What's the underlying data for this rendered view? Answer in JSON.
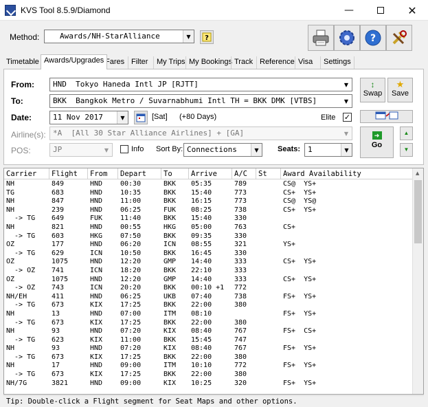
{
  "window": {
    "title": "KVS Tool 8.5.9/Diamond"
  },
  "method": {
    "label": "Method:",
    "value": "Awards/NH-StarAlliance"
  },
  "toolbar": {
    "printer_icon": "printer-icon",
    "settings_icon": "gear-icon",
    "help_icon": "help-icon",
    "tools_icon": "tools-icon"
  },
  "tabs": [
    "Timetable",
    "Awards/Upgrades",
    "Fares",
    "Filter",
    "My Trips",
    "My Bookings",
    "Track",
    "Reference",
    "Visa",
    "Settings"
  ],
  "form": {
    "from_label": "From:",
    "from_value": "HND  Tokyo Haneda Intl JP [RJTT]",
    "to_label": "To:",
    "to_value": "BKK  Bangkok Metro / Suvarnabhumi Intl TH = BKK DMK [VTBS]",
    "date_label": "Date:",
    "date_value": "11 Nov 2017",
    "day_value": "[Sat]",
    "days_offset": "(+80 Days)",
    "elite_label": "Elite",
    "elite_checked": "✓",
    "airlines_label": "Airline(s):",
    "airlines_value": "*A  [All 30 Star Alliance Airlines] + [GA]",
    "pos_label": "POS:",
    "pos_value": "JP",
    "info_label": "Info",
    "sortby_label": "Sort By:",
    "sortby_value": "Connections",
    "seats_label": "Seats:",
    "seats_value": "1",
    "swap_label": "Swap",
    "save_label": "Save",
    "go_label": "Go"
  },
  "grid": {
    "headers": [
      "Carrier",
      "Flight",
      "From",
      "Depart",
      "To",
      "Arrive",
      "A/C",
      "St",
      "Award Availability"
    ],
    "rows": [
      [
        "NH",
        "849",
        "HND",
        "00:30",
        "BKK",
        "05:35",
        "789",
        "",
        "CS@  YS+"
      ],
      [
        "TG",
        "683",
        "HND",
        "10:35",
        "BKK",
        "15:40",
        "773",
        "",
        "CS+  YS+"
      ],
      [
        "NH",
        "847",
        "HND",
        "11:00",
        "BKK",
        "16:15",
        "773",
        "",
        "CS@  YS@"
      ],
      [
        "NH",
        "239",
        "HND",
        "06:25",
        "FUK",
        "08:25",
        "738",
        "",
        "CS+  YS+"
      ],
      [
        "  -> TG",
        "649",
        "FUK",
        "11:40",
        "BKK",
        "15:40",
        "330",
        "",
        ""
      ],
      [
        "NH",
        "821",
        "HND",
        "00:55",
        "HKG",
        "05:00",
        "763",
        "",
        "CS+"
      ],
      [
        "  -> TG",
        "603",
        "HKG",
        "07:50",
        "BKK",
        "09:35",
        "330",
        "",
        ""
      ],
      [
        "OZ",
        "177",
        "HND",
        "06:20",
        "ICN",
        "08:55",
        "321",
        "",
        "YS+"
      ],
      [
        "  -> TG",
        "629",
        "ICN",
        "10:50",
        "BKK",
        "16:45",
        "330",
        "",
        ""
      ],
      [
        "OZ",
        "1075",
        "HND",
        "12:20",
        "GMP",
        "14:40",
        "333",
        "",
        "CS+  YS+"
      ],
      [
        "  -> OZ",
        "741",
        "ICN",
        "18:20",
        "BKK",
        "22:10",
        "333",
        "",
        ""
      ],
      [
        "OZ",
        "1075",
        "HND",
        "12:20",
        "GMP",
        "14:40",
        "333",
        "",
        "CS+  YS+"
      ],
      [
        "  -> OZ",
        "743",
        "ICN",
        "20:20",
        "BKK",
        "00:10 +1",
        "772",
        "",
        ""
      ],
      [
        "NH/EH",
        "411",
        "HND",
        "06:25",
        "UKB",
        "07:40",
        "738",
        "",
        "FS+  YS+"
      ],
      [
        "  -> TG",
        "673",
        "KIX",
        "17:25",
        "BKK",
        "22:00",
        "380",
        "",
        ""
      ],
      [
        "NH",
        "13",
        "HND",
        "07:00",
        "ITM",
        "08:10",
        "",
        "",
        "FS+  YS+"
      ],
      [
        "  -> TG",
        "673",
        "KIX",
        "17:25",
        "BKK",
        "22:00",
        "380",
        "",
        ""
      ],
      [
        "NH",
        "93",
        "HND",
        "07:20",
        "KIX",
        "08:40",
        "767",
        "",
        "FS+  CS+"
      ],
      [
        "  -> TG",
        "623",
        "KIX",
        "11:00",
        "BKK",
        "15:45",
        "747",
        "",
        ""
      ],
      [
        "NH",
        "93",
        "HND",
        "07:20",
        "KIX",
        "08:40",
        "767",
        "",
        "FS+  YS+"
      ],
      [
        "  -> TG",
        "673",
        "KIX",
        "17:25",
        "BKK",
        "22:00",
        "380",
        "",
        ""
      ],
      [
        "NH",
        "17",
        "HND",
        "09:00",
        "ITM",
        "10:10",
        "772",
        "",
        "FS+  YS+"
      ],
      [
        "  -> TG",
        "673",
        "KIX",
        "17:25",
        "BKK",
        "22:00",
        "380",
        "",
        ""
      ],
      [
        "NH/7G",
        "3821",
        "HND",
        "09:00",
        "KIX",
        "10:25",
        "320",
        "",
        "FS+  YS+"
      ]
    ]
  },
  "status": {
    "tip": "Tip: Double-click a Flight segment for Seat Maps and other options."
  }
}
